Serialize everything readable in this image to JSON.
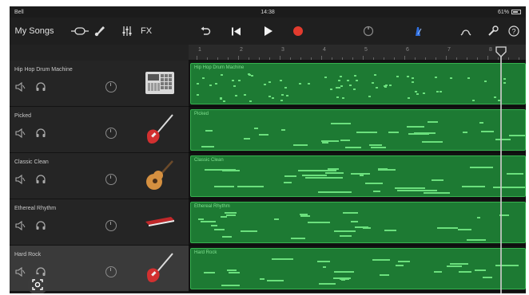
{
  "statusbar": {
    "carrier": "Bell",
    "time": "14:38",
    "battery": "61%"
  },
  "toolbar": {
    "my_songs": "My Songs",
    "fx": "FX"
  },
  "ruler": {
    "marks": [
      "1",
      "2",
      "3",
      "4",
      "5",
      "6",
      "7",
      "8"
    ]
  },
  "tracks": [
    {
      "name": "Hip Hop Drum Machine",
      "region": "Hip Hop Drum Machine",
      "instrument": "drum-machine"
    },
    {
      "name": "Picked",
      "region": "Picked",
      "instrument": "electric-guitar"
    },
    {
      "name": "Classic Clean",
      "region": "Classic Clean",
      "instrument": "acoustic-guitar"
    },
    {
      "name": "Ethereal Rhythm",
      "region": "Ethereal Rhythm",
      "instrument": "synth-keyboard"
    },
    {
      "name": "Hard Rock",
      "region": "Hard Rock",
      "instrument": "electric-guitar"
    }
  ],
  "colors": {
    "region_fill": "#1d7a33",
    "region_border": "#36b24f",
    "record": "#e23b2e",
    "metronome": "#2f6fe0"
  }
}
